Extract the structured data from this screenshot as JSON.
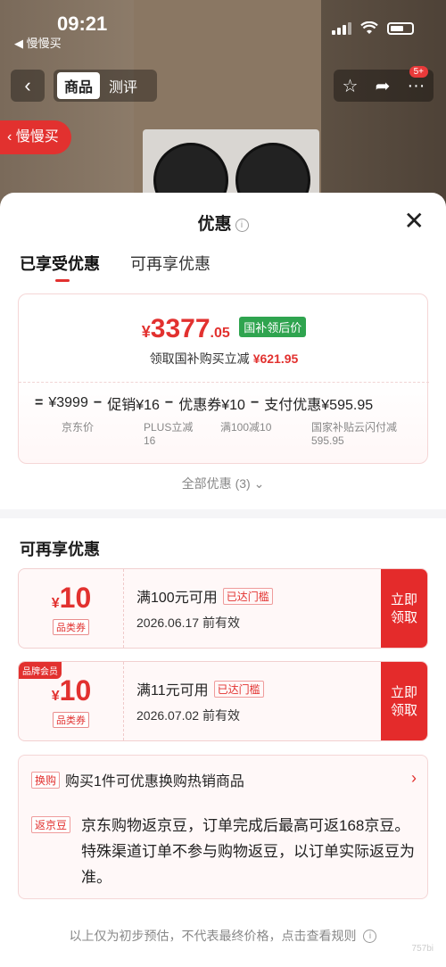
{
  "status_bar": {
    "time": "09:21",
    "back_app": "◀ 慢慢买"
  },
  "nav": {
    "tab_active": "商品",
    "tab_inactive": "测评",
    "badge": "5+"
  },
  "slow_buy": "慢慢买",
  "sheet": {
    "title": "优惠",
    "close": "✕",
    "tabs": [
      "已享受优惠",
      "可再享优惠"
    ]
  },
  "price_card": {
    "currency": "¥",
    "price_int": "3377",
    "price_dec": ".05",
    "tag": "国补领后价",
    "subsidy_label": "领取国补购买立减",
    "subsidy_amount": "¥621.95",
    "breakdown": [
      {
        "op": "=",
        "value": "¥3999",
        "sub": "京东价"
      },
      {
        "op": "−",
        "value": "促销¥16",
        "sub": "PLUS立减 16"
      },
      {
        "op": "−",
        "value": "优惠券¥10",
        "sub": "满100减10"
      },
      {
        "op": "−",
        "value": "支付优惠¥595.95",
        "sub": "国家补贴云闪付减 595.95"
      }
    ]
  },
  "all_offers": "全部优惠 (3) ⌄",
  "section_title": "可再享优惠",
  "coupons": [
    {
      "currency": "¥",
      "value": "10",
      "kind": "品类券",
      "member_tag": "",
      "condition": "满100元可用",
      "status": "已达门槛",
      "expiry": "2026.06.17 前有效",
      "claim": [
        "立即",
        "领取"
      ]
    },
    {
      "currency": "¥",
      "value": "10",
      "kind": "品类券",
      "member_tag": "品牌会员",
      "condition": "满11元可用",
      "status": "已达门槛",
      "expiry": "2026.07.02 前有效",
      "claim": [
        "立即",
        "领取"
      ]
    }
  ],
  "extras": {
    "swap_tag": "换购",
    "swap_text": "购买1件可优惠换购热销商品",
    "bean_tag": "返京豆",
    "bean_text": "京东购物返京豆，订单完成后最高可返168京豆。特殊渠道订单不参与购物返豆，以订单实际返豆为准。"
  },
  "footer_note": "以上仅为初步预估，不代表最终价格，点击查看规则",
  "watermark": "757bi"
}
